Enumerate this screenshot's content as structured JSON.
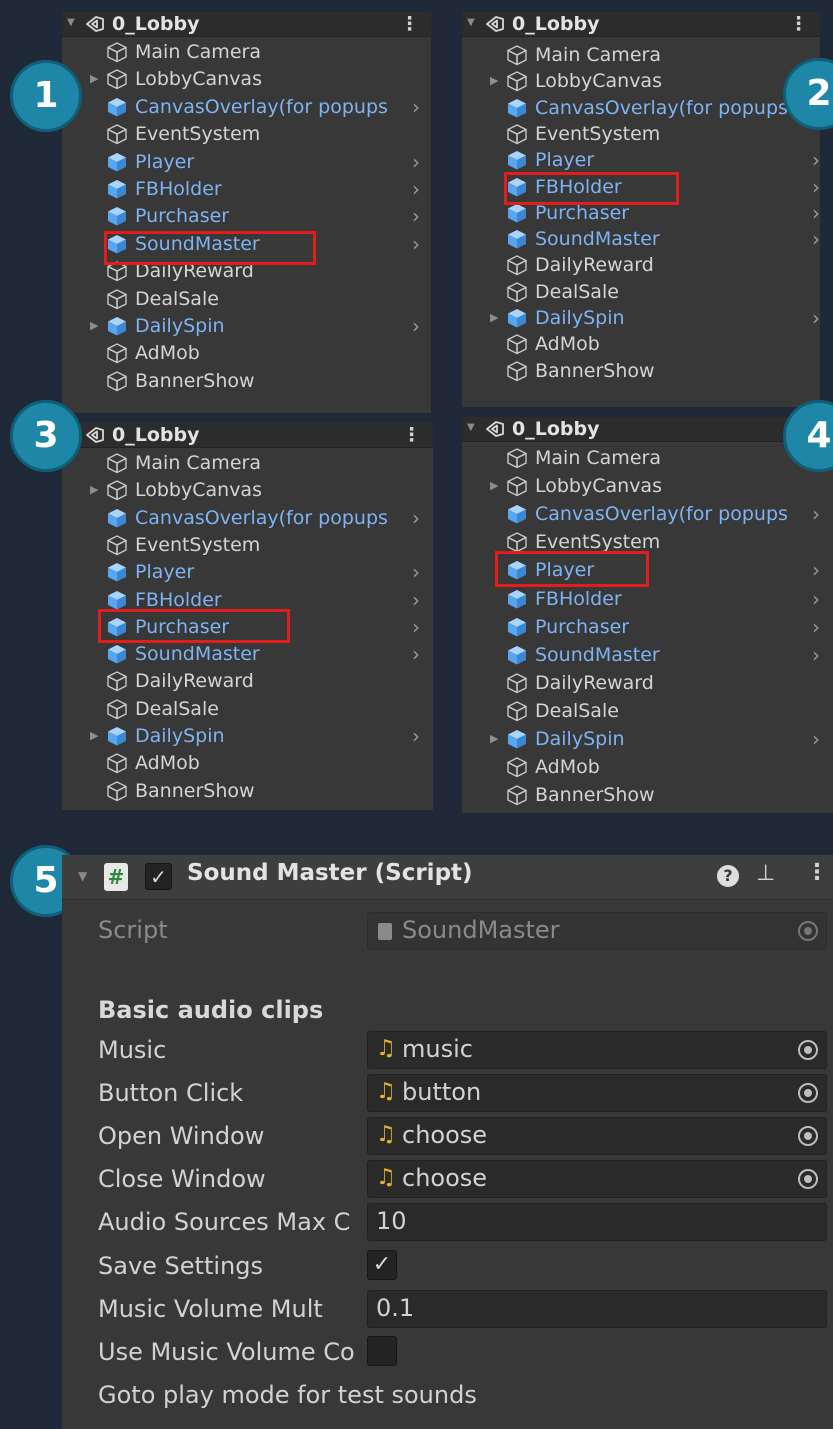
{
  "panels": [
    {
      "scene": "0_Lobby",
      "badge": "1",
      "items": [
        {
          "label": "Main Camera",
          "prefab": false,
          "fold": false,
          "more": false
        },
        {
          "label": "LobbyCanvas",
          "prefab": false,
          "fold": true,
          "more": false
        },
        {
          "label": "CanvasOverlay(for popups",
          "prefab": true,
          "fold": false,
          "more": true
        },
        {
          "label": "EventSystem",
          "prefab": false,
          "fold": false,
          "more": false
        },
        {
          "label": "Player",
          "prefab": true,
          "fold": false,
          "more": true
        },
        {
          "label": "FBHolder",
          "prefab": true,
          "fold": false,
          "more": true
        },
        {
          "label": "Purchaser",
          "prefab": true,
          "fold": false,
          "more": true
        },
        {
          "label": "SoundMaster",
          "prefab": true,
          "fold": false,
          "more": true
        },
        {
          "label": "DailyReward",
          "prefab": false,
          "fold": false,
          "more": false
        },
        {
          "label": "DealSale",
          "prefab": false,
          "fold": false,
          "more": false
        },
        {
          "label": "DailySpin",
          "prefab": true,
          "fold": true,
          "more": true
        },
        {
          "label": "AdMob",
          "prefab": false,
          "fold": false,
          "more": false
        },
        {
          "label": "BannerShow",
          "prefab": false,
          "fold": false,
          "more": false
        }
      ],
      "highlighted": "SoundMaster"
    },
    {
      "scene": "0_Lobby",
      "badge": "2",
      "items": [
        {
          "label": "Main Camera",
          "prefab": false,
          "fold": false,
          "more": false
        },
        {
          "label": "LobbyCanvas",
          "prefab": false,
          "fold": true,
          "more": false
        },
        {
          "label": "CanvasOverlay(for popups",
          "prefab": true,
          "fold": false,
          "more": true
        },
        {
          "label": "EventSystem",
          "prefab": false,
          "fold": false,
          "more": false
        },
        {
          "label": "Player",
          "prefab": true,
          "fold": false,
          "more": true
        },
        {
          "label": "FBHolder",
          "prefab": true,
          "fold": false,
          "more": true
        },
        {
          "label": "Purchaser",
          "prefab": true,
          "fold": false,
          "more": true
        },
        {
          "label": "SoundMaster",
          "prefab": true,
          "fold": false,
          "more": true
        },
        {
          "label": "DailyReward",
          "prefab": false,
          "fold": false,
          "more": false
        },
        {
          "label": "DealSale",
          "prefab": false,
          "fold": false,
          "more": false
        },
        {
          "label": "DailySpin",
          "prefab": true,
          "fold": true,
          "more": true
        },
        {
          "label": "AdMob",
          "prefab": false,
          "fold": false,
          "more": false
        },
        {
          "label": "BannerShow",
          "prefab": false,
          "fold": false,
          "more": false
        }
      ],
      "highlighted": "FBHolder"
    },
    {
      "scene": "0_Lobby",
      "badge": "3",
      "items": [
        {
          "label": "Main Camera",
          "prefab": false,
          "fold": false,
          "more": false
        },
        {
          "label": "LobbyCanvas",
          "prefab": false,
          "fold": true,
          "more": false
        },
        {
          "label": "CanvasOverlay(for popups",
          "prefab": true,
          "fold": false,
          "more": true
        },
        {
          "label": "EventSystem",
          "prefab": false,
          "fold": false,
          "more": false
        },
        {
          "label": "Player",
          "prefab": true,
          "fold": false,
          "more": true
        },
        {
          "label": "FBHolder",
          "prefab": true,
          "fold": false,
          "more": true
        },
        {
          "label": "Purchaser",
          "prefab": true,
          "fold": false,
          "more": true
        },
        {
          "label": "SoundMaster",
          "prefab": true,
          "fold": false,
          "more": true
        },
        {
          "label": "DailyReward",
          "prefab": false,
          "fold": false,
          "more": false
        },
        {
          "label": "DealSale",
          "prefab": false,
          "fold": false,
          "more": false
        },
        {
          "label": "DailySpin",
          "prefab": true,
          "fold": true,
          "more": true
        },
        {
          "label": "AdMob",
          "prefab": false,
          "fold": false,
          "more": false
        },
        {
          "label": "BannerShow",
          "prefab": false,
          "fold": false,
          "more": false
        }
      ],
      "highlighted": "Purchaser"
    },
    {
      "scene": "0_Lobby",
      "badge": "4",
      "items": [
        {
          "label": "Main Camera",
          "prefab": false,
          "fold": false,
          "more": false
        },
        {
          "label": "LobbyCanvas",
          "prefab": false,
          "fold": true,
          "more": false
        },
        {
          "label": "CanvasOverlay(for popups",
          "prefab": true,
          "fold": false,
          "more": true
        },
        {
          "label": "EventSystem",
          "prefab": false,
          "fold": false,
          "more": false
        },
        {
          "label": "Player",
          "prefab": true,
          "fold": false,
          "more": true
        },
        {
          "label": "FBHolder",
          "prefab": true,
          "fold": false,
          "more": true
        },
        {
          "label": "Purchaser",
          "prefab": true,
          "fold": false,
          "more": true
        },
        {
          "label": "SoundMaster",
          "prefab": true,
          "fold": false,
          "more": true
        },
        {
          "label": "DailyReward",
          "prefab": false,
          "fold": false,
          "more": false
        },
        {
          "label": "DealSale",
          "prefab": false,
          "fold": false,
          "more": false
        },
        {
          "label": "DailySpin",
          "prefab": true,
          "fold": true,
          "more": true
        },
        {
          "label": "AdMob",
          "prefab": false,
          "fold": false,
          "more": false
        },
        {
          "label": "BannerShow",
          "prefab": false,
          "fold": false,
          "more": false
        }
      ],
      "highlighted": "Player"
    }
  ],
  "inspector": {
    "badge": "5",
    "title": "Sound Master (Script)",
    "enabled": true,
    "script_label": "Script",
    "script_value": "SoundMaster",
    "section": "Basic audio clips",
    "clips": [
      {
        "label": "Music",
        "value": "music"
      },
      {
        "label": "Button Click",
        "value": "button"
      },
      {
        "label": "Open Window",
        "value": "choose"
      },
      {
        "label": "Close Window",
        "value": "choose"
      }
    ],
    "max_sources_label": "Audio Sources Max C",
    "max_sources_value": "10",
    "save_settings_label": "Save Settings",
    "save_settings_checked": true,
    "music_volume_label": "Music Volume Mult",
    "music_volume_value": "0.1",
    "use_music_volume_label": "Use Music Volume Co",
    "use_music_volume_checked": false,
    "footer": "Goto play mode for test sounds"
  },
  "colors": {
    "background": "#1f2836",
    "prefab_text": "#7fb3f2",
    "highlight": "#e01e1e",
    "badge": "#1e87a8",
    "audio_icon": "#e0b22e"
  }
}
